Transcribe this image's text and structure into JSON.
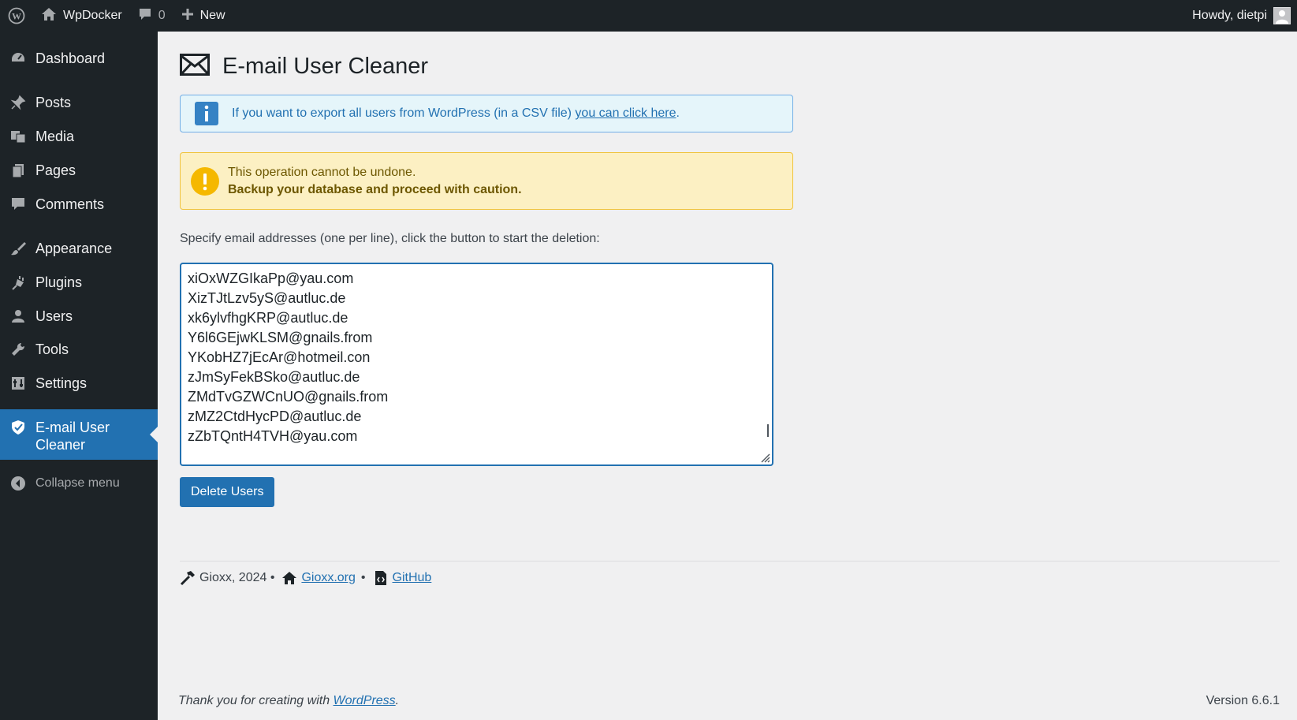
{
  "adminbar": {
    "site_name": "WpDocker",
    "comments_count": "0",
    "new_label": "New",
    "howdy": "Howdy, dietpi"
  },
  "sidebar": {
    "items": [
      {
        "label": "Dashboard",
        "icon": "dashboard-icon"
      },
      {
        "label": "Posts",
        "icon": "pin-icon"
      },
      {
        "label": "Media",
        "icon": "media-icon"
      },
      {
        "label": "Pages",
        "icon": "pages-icon"
      },
      {
        "label": "Comments",
        "icon": "comment-icon"
      },
      {
        "label": "Appearance",
        "icon": "paintbrush-icon"
      },
      {
        "label": "Plugins",
        "icon": "plugin-icon"
      },
      {
        "label": "Users",
        "icon": "user-icon"
      },
      {
        "label": "Tools",
        "icon": "wrench-icon"
      },
      {
        "label": "Settings",
        "icon": "settings-icon"
      }
    ],
    "active": {
      "line1": "E-mail User",
      "line2": "Cleaner",
      "icon": "shield-icon"
    },
    "collapse_label": "Collapse menu"
  },
  "page": {
    "title": "E-mail User Cleaner",
    "info_text": "If you want to export all users from WordPress (in a CSV file) ",
    "info_link": "you can click here",
    "info_suffix": ".",
    "warn_line1": "This operation cannot be undone.",
    "warn_line2": "Backup your database and proceed with caution.",
    "instructions": "Specify email addresses (one per line), click the button to start the deletion:",
    "emails": [
      "xiOxWZGIkaPp@yau.com",
      "XizTJtLzv5yS@autluc.de",
      "xk6ylvfhgKRP@autluc.de",
      "Y6l6GEjwKLSM@gnails.from",
      "YKobHZ7jEcAr@hotmeil.con",
      "zJmSyFekBSko@autluc.de",
      "ZMdTvGZWCnUO@gnails.from",
      "zMZ2CtdHycPD@autluc.de",
      "zZbTQntH4TVH@yau.com"
    ],
    "delete_button": "Delete Users"
  },
  "credits": {
    "author": "Gioxx, 2024 •",
    "site_link": "Gioxx.org",
    "sep": "•",
    "github_link": "GitHub"
  },
  "footer": {
    "thanks": "Thank you for creating with ",
    "wp_link": "WordPress",
    "thanks_suffix": ".",
    "version": "Version 6.6.1"
  },
  "colors": {
    "adminbar_bg": "#1d2327",
    "accent": "#2271b1",
    "info_bg": "#e5f5fa",
    "warn_bg": "#fcf0c3",
    "warn_icon": "#f0b849"
  }
}
